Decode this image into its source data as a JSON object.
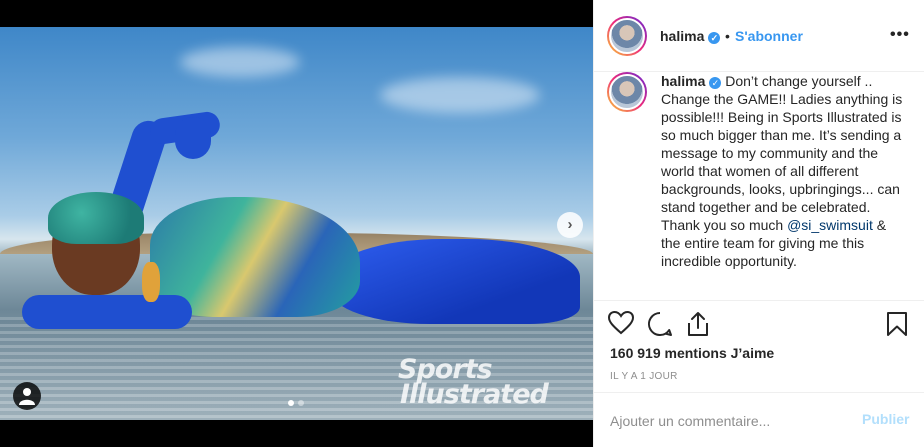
{
  "post": {
    "username": "halima",
    "separator": "•",
    "follow_label": "S'abonner",
    "more_label": "•••",
    "caption_prefix": "Don’t change yourself .. Change the GAME!! Ladies anything is possible!!! Being in Sports Illustrated is so much bigger than me. It’s sending a message to my community and the world that women of all different backgrounds, looks, upbringings... can stand together and be celebrated. Thank you so much ",
    "caption_mention": "@si_swimsuit",
    "caption_suffix": " & the entire team for giving me this incredible opportunity.",
    "likes_text": "160 919 mentions J’aime",
    "time_text": "IL Y A 1 JOUR"
  },
  "media": {
    "watermark_line1": "Sports",
    "watermark_line2": "Illustrated",
    "next_label": "›",
    "carousel_count": 2,
    "carousel_active": 1
  },
  "comment": {
    "placeholder": "Ajouter un commentaire...",
    "publish_label": "Publier"
  },
  "icons": {
    "verified": "verified-badge-icon",
    "like": "heart-icon",
    "comment": "comment-bubble-icon",
    "share": "share-icon",
    "save": "bookmark-icon",
    "user_tag": "user-icon"
  },
  "colors": {
    "accent": "#3897f0",
    "publish_disabled": "#b2dffc",
    "mention": "#00376b",
    "muted": "#8e8e8e"
  }
}
